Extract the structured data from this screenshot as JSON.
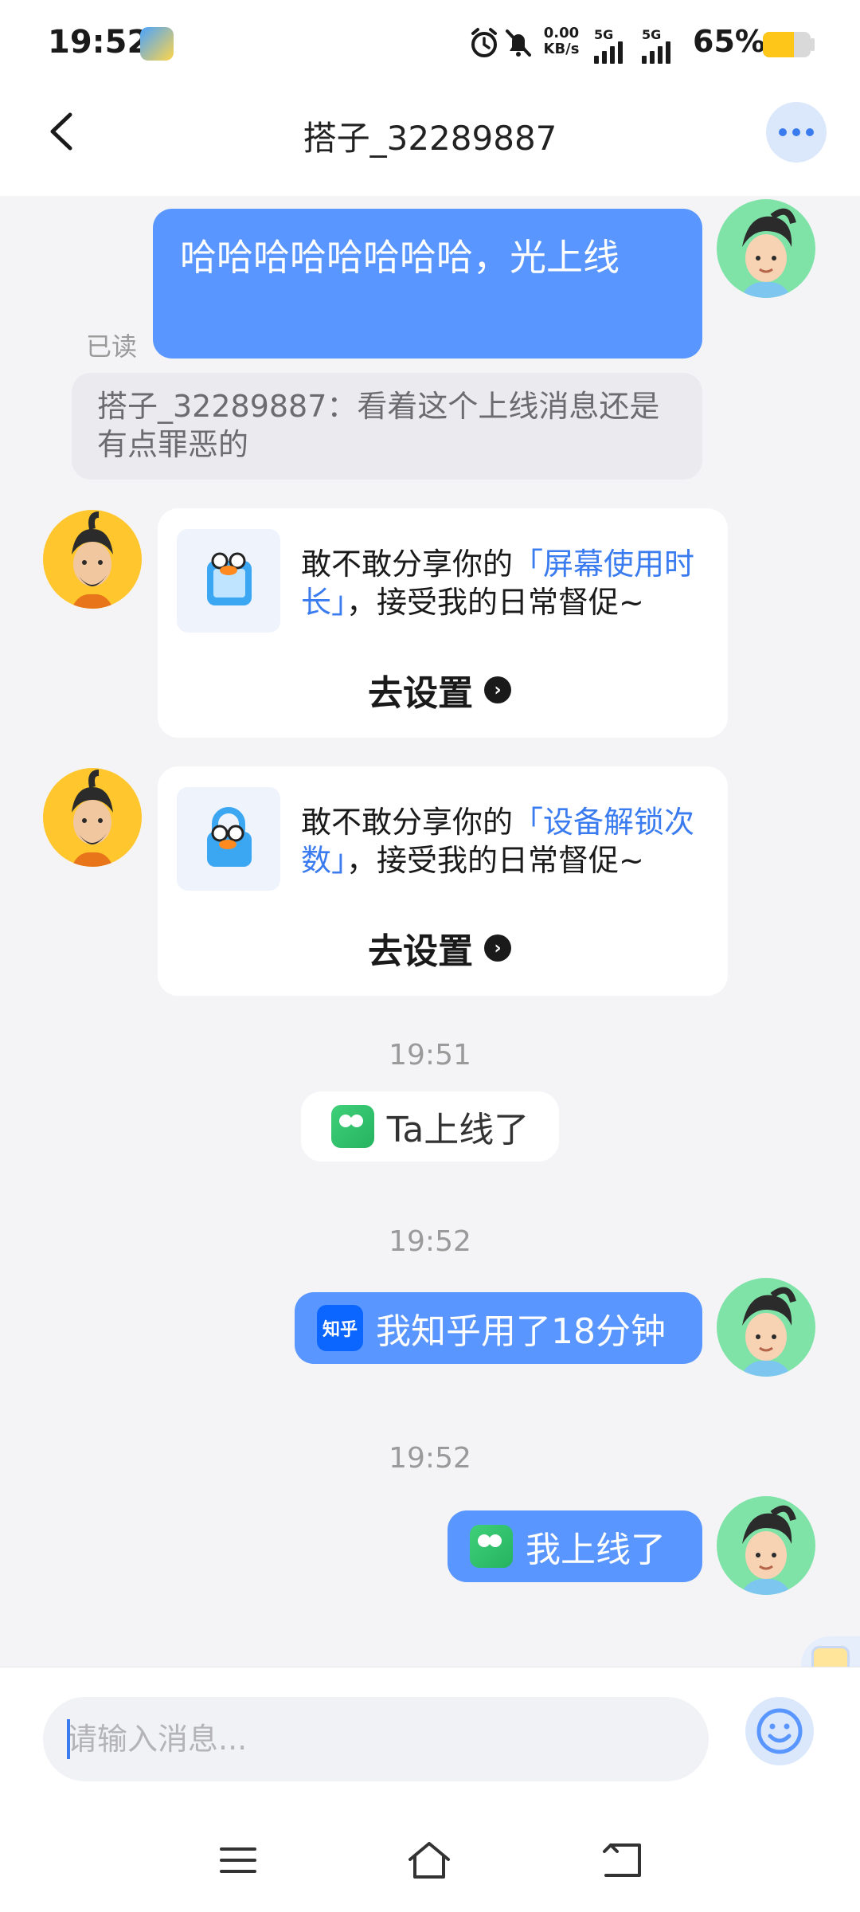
{
  "status_bar": {
    "time": "19:52",
    "net_speed_value": "0.00",
    "net_speed_unit": "KB/s",
    "sim1_label": "5G",
    "sim2_label": "5G",
    "battery_text": "65%",
    "battery_level": 0.65,
    "icons": [
      "app-notification-icon",
      "alarm-icon",
      "mute-icon",
      "signal-icon",
      "battery-icon"
    ]
  },
  "header": {
    "title": "搭子_32289887",
    "back_icon": "chevron-left-icon",
    "more_icon": "more-dots-icon"
  },
  "messages": {
    "sent_text": {
      "text": "哈哈哈哈哈哈哈哈，光上线",
      "read_status": "已读"
    },
    "quote": {
      "text": "搭子_32289887：看着这个上线消息还是有点罪恶的"
    },
    "card_screen_time": {
      "prefix": "敢不敢分享你的",
      "highlight": "「屏幕使用时长」",
      "suffix": "，接受我的日常督促~",
      "action": "去设置",
      "icon": "screen-time-icon"
    },
    "card_unlock": {
      "prefix": "敢不敢分享你的",
      "highlight": "「设备解锁次数」",
      "suffix": "，接受我的日常督促~",
      "action": "去设置",
      "icon": "unlock-count-icon"
    },
    "time_1": "19:51",
    "partner_online": "Ta上线了",
    "time_2": "19:52",
    "zhihu": {
      "badge": "知乎",
      "text": "我知乎用了18分钟"
    },
    "time_3": "19:52",
    "self_online": "我上线了"
  },
  "input": {
    "placeholder": "请输入消息..."
  },
  "nav": {
    "icons": [
      "menu-icon",
      "home-icon",
      "back-icon"
    ]
  },
  "colors": {
    "accent": "#5a96ff",
    "link": "#3a7bf0",
    "background": "#f4f4f6"
  }
}
